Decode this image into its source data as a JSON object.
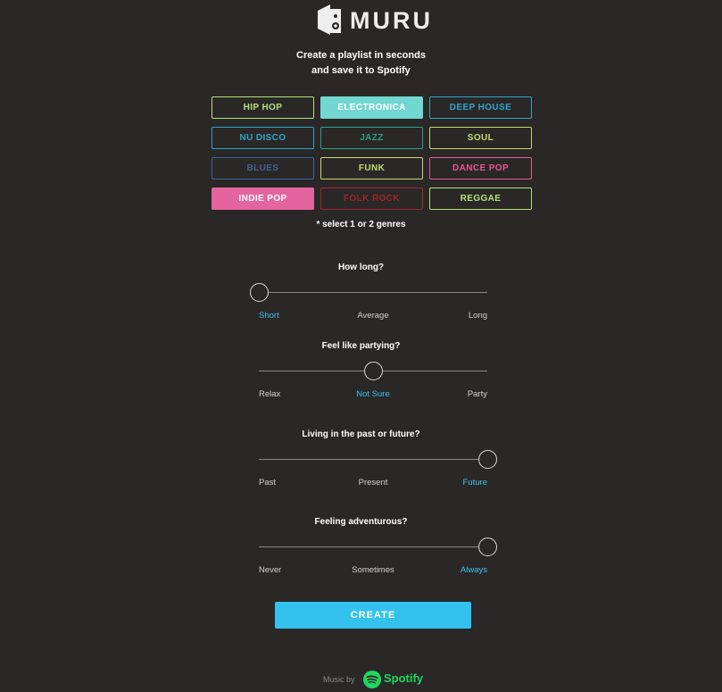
{
  "brand": {
    "name": "MURU"
  },
  "tagline": {
    "line1": "Create a playlist in seconds",
    "line2": "and save it to Spotify"
  },
  "genres": [
    {
      "label": "HIP HOP",
      "color": "#b5e07a",
      "selected": false
    },
    {
      "label": "ELECTRONICA",
      "color": "#72d6d1",
      "selected": true
    },
    {
      "label": "DEEP HOUSE",
      "color": "#2fa5c7",
      "selected": false
    },
    {
      "label": "NU DISCO",
      "color": "#2fa5c7",
      "selected": false
    },
    {
      "label": "JAZZ",
      "color": "#27a383",
      "selected": false
    },
    {
      "label": "SOUL",
      "color": "#c3da6e",
      "selected": false
    },
    {
      "label": "BLUES",
      "color": "#43629a",
      "selected": false
    },
    {
      "label": "FUNK",
      "color": "#c3da6e",
      "selected": false
    },
    {
      "label": "DANCE POP",
      "color": "#e8578f",
      "selected": false
    },
    {
      "label": "INDIE POP",
      "color": "#e4659e",
      "selected": true
    },
    {
      "label": "FOLK ROCK",
      "color": "#a2252d",
      "selected": false
    },
    {
      "label": "REGGAE",
      "color": "#b5e07a",
      "selected": false
    }
  ],
  "genre_hint": "* select 1 or 2 genres",
  "questions": [
    {
      "title": "How long?",
      "options": [
        "Short",
        "Average",
        "Long"
      ],
      "selected_index": 0
    },
    {
      "title": "Feel like partying?",
      "options": [
        "Relax",
        "Not Sure",
        "Party"
      ],
      "selected_index": 1
    },
    {
      "title": "Living in the past or future?",
      "options": [
        "Past",
        "Present",
        "Future"
      ],
      "selected_index": 2
    },
    {
      "title": "Feeling adventurous?",
      "options": [
        "Never",
        "Sometimes",
        "Always"
      ],
      "selected_index": 2
    }
  ],
  "create_label": "CREATE",
  "footer": {
    "music_by": "Music by",
    "spotify": "Spotify"
  },
  "colors": {
    "background": "#2a2727",
    "accent": "#33c2ee",
    "spotify_green": "#1ed760"
  }
}
